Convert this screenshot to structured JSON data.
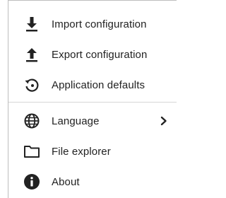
{
  "menu": {
    "items": [
      {
        "label": "Import configuration",
        "icon": "download-icon"
      },
      {
        "label": "Export configuration",
        "icon": "upload-icon"
      },
      {
        "label": "Application defaults",
        "icon": "restore-icon"
      },
      {
        "label": "Language",
        "icon": "globe-icon",
        "submenu": true
      },
      {
        "label": "File explorer",
        "icon": "folder-icon"
      },
      {
        "label": "About",
        "icon": "info-icon"
      }
    ]
  }
}
